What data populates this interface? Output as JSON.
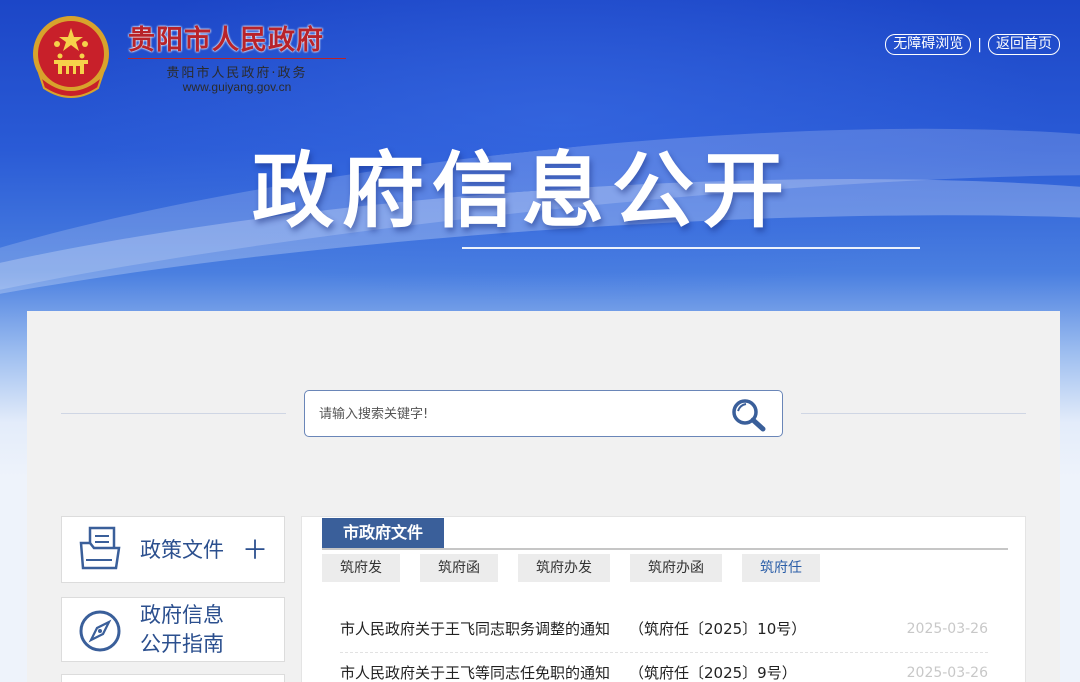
{
  "header": {
    "site_title": "贵阳市人民政府",
    "site_subtitle": "贵阳市人民政府·政务",
    "site_url": "www.guiyang.gov.cn",
    "links": [
      "无障碍浏览",
      "返回首页"
    ],
    "separator": "|",
    "page_title": "政府信息公开"
  },
  "search": {
    "placeholder": "请输入搜索关键字!",
    "icon": "search-icon"
  },
  "sidebar": {
    "items": [
      {
        "label": "政策文件",
        "icon": "document-folder-icon",
        "expand": "＋"
      },
      {
        "label_line1": "政府信息",
        "label_line2": "公开指南",
        "icon": "compass-icon"
      }
    ]
  },
  "content": {
    "section_title": "市政府文件",
    "tabs": [
      "筑府发",
      "筑府函",
      "筑府办发",
      "筑府办函",
      "筑府任"
    ],
    "active_tab": "筑府任",
    "items": [
      {
        "title": "市人民政府关于王飞同志职务调整的通知",
        "doc_no": "（筑府任〔2025〕10号）",
        "date": "2025-03-26"
      },
      {
        "title": "市人民政府关于王飞等同志任免职的通知",
        "doc_no": "（筑府任〔2025〕9号）",
        "date": "2025-03-26"
      }
    ]
  },
  "colors": {
    "title_red": "#b8232a",
    "accent_blue": "#3a5f9a",
    "link_blue": "#2b4f8e"
  }
}
